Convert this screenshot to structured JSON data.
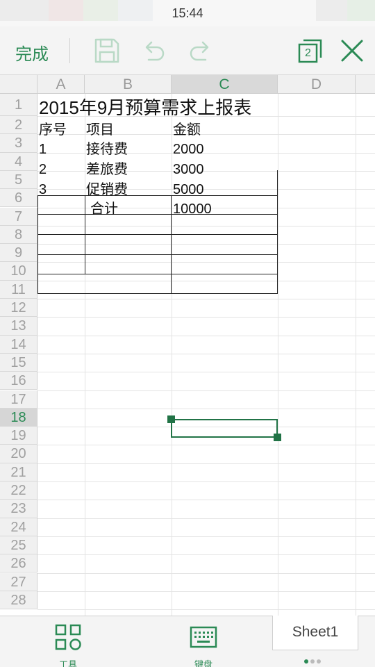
{
  "status_bar": {
    "time": "15:44"
  },
  "toolbar": {
    "done_label": "完成",
    "window_count": "2",
    "accent_color": "#2b8a55",
    "icons": [
      "save-icon",
      "undo-icon",
      "redo-icon",
      "windows-icon",
      "close-icon"
    ]
  },
  "spreadsheet": {
    "columns": [
      "A",
      "B",
      "C",
      "D"
    ],
    "active_column": "C",
    "rows": [
      "1",
      "2",
      "3",
      "4",
      "5",
      "6",
      "7",
      "8",
      "9",
      "10",
      "11",
      "12",
      "13",
      "14",
      "15",
      "16",
      "17",
      "18",
      "19",
      "20",
      "21",
      "22",
      "23",
      "24",
      "25",
      "26",
      "27",
      "28"
    ],
    "active_row": "18",
    "title": "2015年9月预算需求上报表",
    "headers": {
      "seq": "序号",
      "item": "项目",
      "amount": "金额"
    },
    "data_rows": [
      {
        "seq": "1",
        "item": "接待费",
        "amount": "2000"
      },
      {
        "seq": "2",
        "item": "差旅费",
        "amount": "3000"
      },
      {
        "seq": "3",
        "item": "促销费",
        "amount": "5000"
      }
    ],
    "total": {
      "label": "合计",
      "amount": "10000"
    }
  },
  "bottom_bar": {
    "tools_label": "工具",
    "keyboard_label": "键盘",
    "sheet_tab": "Sheet1"
  }
}
